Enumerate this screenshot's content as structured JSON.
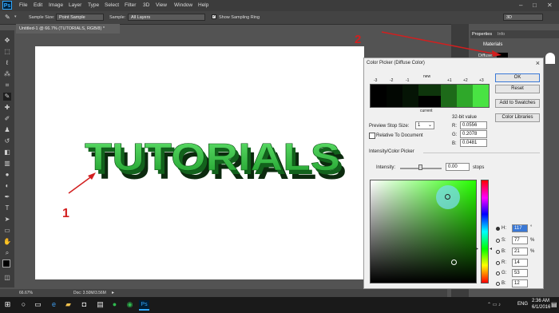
{
  "menubar": {
    "logo": "Ps",
    "items": [
      "File",
      "Edit",
      "Image",
      "Layer",
      "Type",
      "Select",
      "Filter",
      "3D",
      "View",
      "Window",
      "Help"
    ],
    "window_buttons": {
      "minimize": "–",
      "maximize": "□",
      "close": "✕"
    }
  },
  "options": {
    "sample_size_label": "Sample Size:",
    "sample_size_value": "Point Sample",
    "sample_label": "Sample:",
    "sample_value": "All Layers",
    "show_sampling_ring_label": "Show Sampling Ring",
    "workspace_value": "3D"
  },
  "document": {
    "tab_title": "Untitled-1 @ 66.7% (TUTORIALS, RGB/8) *",
    "canvas_text": "TUTORIALS"
  },
  "annotations": {
    "marker_one": "1",
    "marker_two": "2"
  },
  "statusbar": {
    "zoom": "66.67%",
    "doc": "Doc: 3.50M/3.56M"
  },
  "right_panel": {
    "tabs": [
      "Properties",
      "Info"
    ],
    "section": "Materials",
    "diffuse_label": "Diffuse:"
  },
  "color_picker": {
    "title": "Color Picker (Diffuse Color)",
    "stop_labels": [
      "-3",
      "-2",
      "-1",
      "new",
      "+1",
      "+2",
      "+3"
    ],
    "current_label": "current",
    "ok": "OK",
    "reset": "Reset",
    "add_to_swatches": "Add to Swatches",
    "color_libraries": "Color Libraries",
    "bit_value_label": "32-bit value",
    "preview_stop_size_label": "Preview Stop Size:",
    "preview_stop_size_value": "1",
    "relative_to_document": "Relative To Document",
    "r_label": "R:",
    "r_value": "0.0556",
    "g_label": "G:",
    "g_value": "0.2078",
    "b_label": "B:",
    "b_value": "0.0481",
    "intensity_section": "Intensity/Color Picker",
    "intensity_label": "Intensity:",
    "intensity_value": "0.00",
    "intensity_unit": "stops",
    "hsb_rgb": [
      {
        "label": "H:",
        "value": "117",
        "unit": "°"
      },
      {
        "label": "S:",
        "value": "77",
        "unit": "%"
      },
      {
        "label": "B:",
        "value": "21",
        "unit": "%"
      },
      {
        "label": "R:",
        "value": "14",
        "unit": ""
      },
      {
        "label": "G:",
        "value": "53",
        "unit": ""
      },
      {
        "label": "B:",
        "value": "12",
        "unit": ""
      }
    ]
  },
  "taskbar": {
    "language": "ENG",
    "time": "2:36 AM",
    "date": "6/1/2016"
  }
}
